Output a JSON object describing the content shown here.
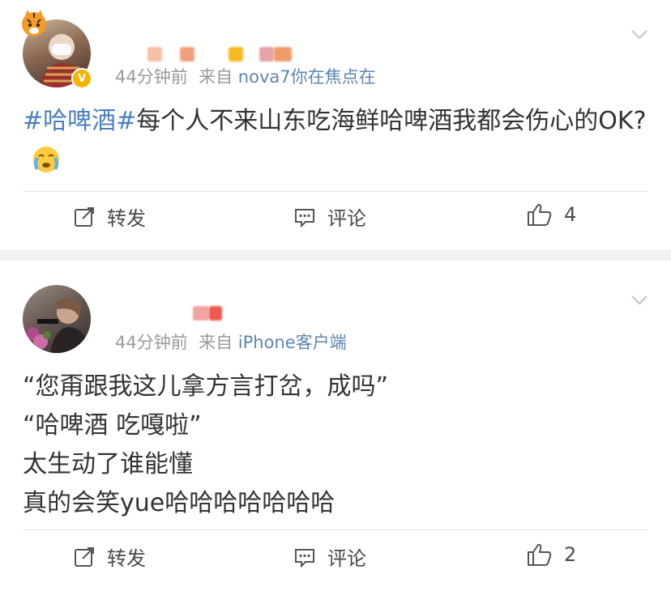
{
  "posts": [
    {
      "meta": {
        "time": "44分钟前",
        "via": "来自",
        "source": "nova7你在焦点在"
      },
      "content": {
        "hashtag": "#哈啤酒#",
        "text": "每个人不来山东吃海鲜哈啤酒我都会伤心的OK?"
      },
      "actions": {
        "repost_label": "转发",
        "comment_label": "评论",
        "like_count": "4"
      },
      "icons": [
        "tiger-icon",
        "verified-badge-icon",
        "crying-face-emoji",
        "chevron-down-icon"
      ]
    },
    {
      "meta": {
        "time": "44分钟前",
        "via": "来自",
        "source": "iPhone客户端"
      },
      "content": {
        "lines": [
          "“您甭跟我这儿拿方言打岔，成吗”",
          "“哈啤酒 吃嘎啦”",
          "太生动了谁能懂",
          "真的会笑yue哈哈哈哈哈哈哈"
        ]
      },
      "actions": {
        "repost_label": "转发",
        "comment_label": "评论",
        "like_count": "2"
      },
      "icons": [
        "chevron-down-icon"
      ]
    }
  ],
  "colors": {
    "hashtag": "#4a7fc1",
    "source_link": "#5c86b0",
    "meta_gray": "#9a9a9a",
    "badge_gold": "#f5b400",
    "page_bg": "#f2f2f2"
  }
}
